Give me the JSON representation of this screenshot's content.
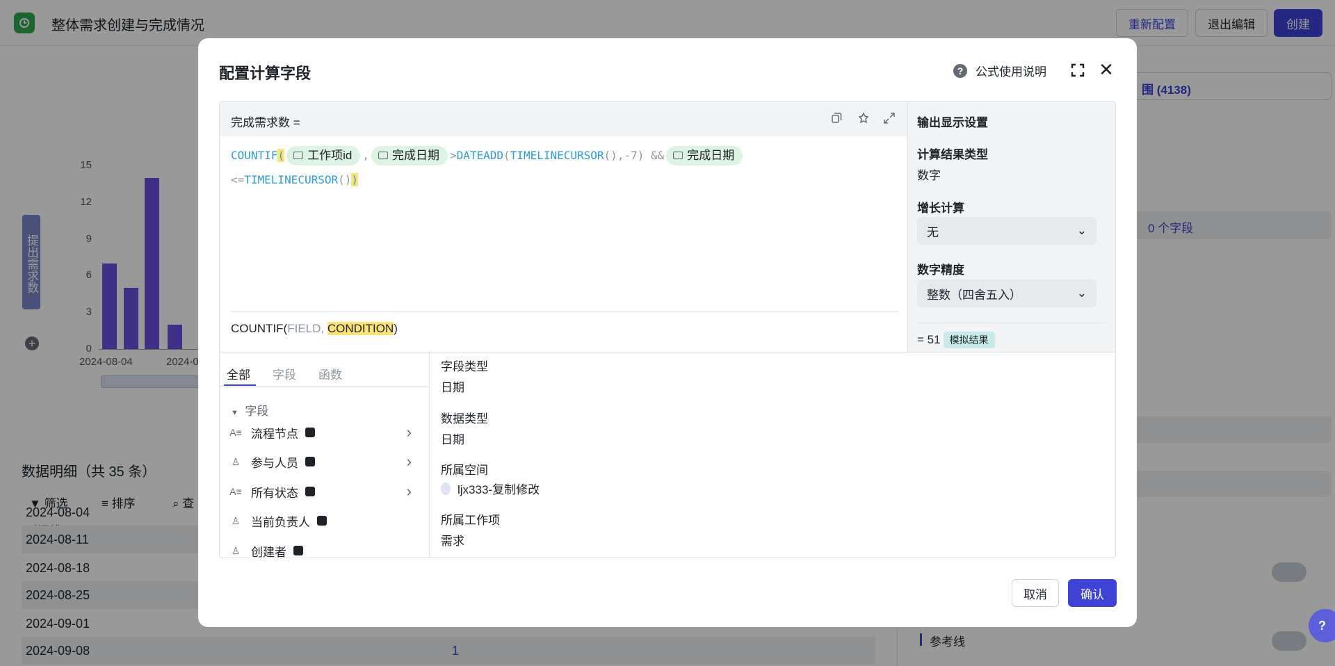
{
  "app": {
    "title": "整体需求创建与完成情况",
    "reconfig_label": "重新配置",
    "exit_label": "退出编辑",
    "create_label": "创建"
  },
  "chart_data": {
    "type": "bar",
    "title": "",
    "ylabel": "提出需求数",
    "yticks": [
      "15",
      "12",
      "9",
      "6",
      "3",
      "0"
    ],
    "ylim": [
      0,
      15
    ],
    "categories": [
      "2024-08-04",
      "",
      "",
      "",
      ""
    ],
    "visible_tick_labels": [
      "2024-08-04",
      "2024-0"
    ],
    "values": [
      7,
      5,
      14,
      2
    ]
  },
  "detail": {
    "title": "数据明细（共 35 条）",
    "filter_label": "筛选",
    "sort_label": "排序",
    "tool3_label": "查",
    "column_header": "时间线",
    "rows": [
      "2024-08-04",
      "2024-08-11",
      "2024-08-18",
      "2024-08-25",
      "2024-09-01",
      "2024-09-08"
    ],
    "row6_value": "1"
  },
  "right_panel": {
    "count_text": "围 (4138)",
    "fields_text": "0 个字段",
    "refline_label": "参考线"
  },
  "modal": {
    "title": "配置计算字段",
    "help_label": "公式使用说明",
    "formula_name": "完成需求数 =",
    "code": {
      "fn_countif": "COUNTIF",
      "chip1": "工作项id",
      "chip2": "完成日期",
      "gt": ">",
      "fn_dateadd": "DATEADD",
      "fn_cursor": "TIMELINECURSOR",
      "paren_comma": "(),",
      "neg": "-7)",
      "and": "&&",
      "chip3": "完成日期",
      "le": "<=",
      "fn_cursor2": "TIMELINECURSOR",
      "paren2": "()",
      "close": ")"
    },
    "signature": {
      "fn": "COUNTIF(",
      "arg1": "FIELD",
      "sep": ", ",
      "arg2": "CONDITION",
      "end": ")"
    },
    "output": {
      "title": "输出显示设置",
      "result_type_label": "计算结果类型",
      "result_type_value": "数字",
      "growth_label": "增长计算",
      "growth_value": "无",
      "precision_label": "数字精度",
      "precision_value": "整数（四舍五入）",
      "sim_value": "= 51",
      "sim_tag": "模拟结果"
    },
    "tabs": [
      "全部",
      "字段",
      "函数"
    ],
    "section_label": "字段",
    "fields": [
      {
        "icon": "A≡",
        "label": "流程节点"
      },
      {
        "icon": "♙",
        "label": "参与人员"
      },
      {
        "icon": "A≡",
        "label": "所有状态"
      },
      {
        "icon": "♙",
        "label": "当前负责人"
      },
      {
        "icon": "♙",
        "label": "创建者"
      }
    ],
    "props": {
      "field_type_label": "字段类型",
      "field_type_value": "日期",
      "data_type_label": "数据类型",
      "data_type_value": "日期",
      "space_label": "所属空间",
      "space_value": "ljx333-复制修改",
      "workitem_label": "所属工作项",
      "workitem_value": "需求"
    },
    "cancel_label": "取消",
    "ok_label": "确认"
  },
  "colors": {
    "accent": "#3f44d6",
    "bar": "#6b4fe0",
    "chip": "#dcf2e2",
    "highlight": "#ffe27a"
  }
}
